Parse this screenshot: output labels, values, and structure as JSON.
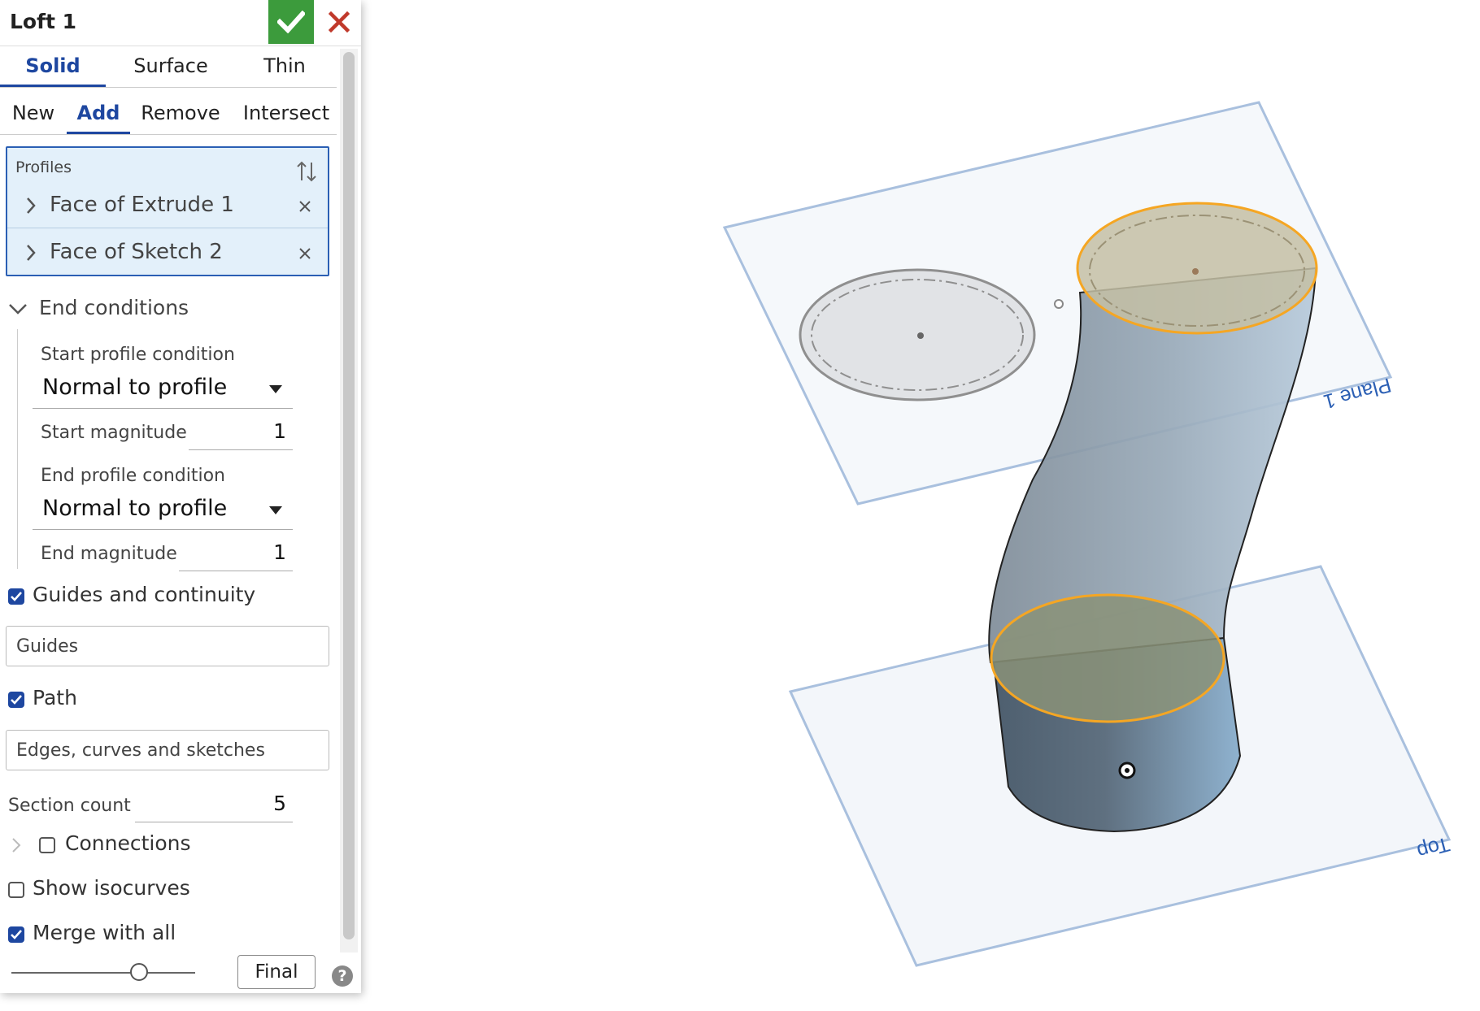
{
  "feature": {
    "title": "Loft 1",
    "ok_icon": "check-icon",
    "cancel_icon": "close-icon",
    "accent_color": "#1e47a0",
    "ok_color": "#3c9b3c",
    "cancel_color": "#c0392b"
  },
  "body_type_tabs": [
    {
      "label": "Solid",
      "active": true
    },
    {
      "label": "Surface",
      "active": false
    },
    {
      "label": "Thin",
      "active": false
    }
  ],
  "operation_tabs": [
    {
      "label": "New",
      "active": false
    },
    {
      "label": "Add",
      "active": true
    },
    {
      "label": "Remove",
      "active": false
    },
    {
      "label": "Intersect",
      "active": false
    }
  ],
  "profiles": {
    "label": "Profiles",
    "reorder_icon": "reorder-arrows-icon",
    "items": [
      {
        "label": "Face of Extrude 1"
      },
      {
        "label": "Face of Sketch 2"
      }
    ]
  },
  "end_conditions": {
    "label": "End conditions",
    "expanded": true,
    "start_condition_label": "Start profile condition",
    "start_condition_value": "Normal to profile",
    "start_magnitude_label": "Start magnitude",
    "start_magnitude_value": "1",
    "end_condition_label": "End profile condition",
    "end_condition_value": "Normal to profile",
    "end_magnitude_label": "End magnitude",
    "end_magnitude_value": "1"
  },
  "guides_continuity": {
    "label": "Guides and continuity",
    "checked": true
  },
  "guides_field": {
    "placeholder": "Guides"
  },
  "path": {
    "label": "Path",
    "checked": true
  },
  "path_field": {
    "placeholder": "Edges, curves and sketches"
  },
  "section_count": {
    "label": "Section count",
    "value": "5"
  },
  "connections": {
    "label": "Connections",
    "checked": false
  },
  "show_isocurves": {
    "label": "Show isocurves",
    "checked": false
  },
  "merge_with_all": {
    "label": "Merge with all",
    "checked": true
  },
  "footer": {
    "final_label": "Final",
    "help_label": "?"
  },
  "viewport": {
    "plane1_label": "Plane 1",
    "top_label": "Top",
    "plane_color": "#a9c0de",
    "profile_highlight_color": "#f5a623"
  }
}
